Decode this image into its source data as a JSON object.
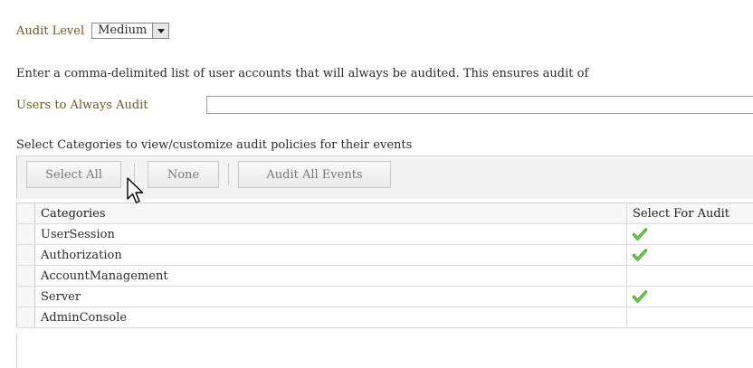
{
  "audit_level": {
    "label": "Audit Level",
    "value": "Medium"
  },
  "description": "Enter a comma-delimited list of user accounts that will always be audited. This ensures audit of",
  "users_field": {
    "label": "Users to Always Audit",
    "value": ""
  },
  "categories_heading": "Select Categories to view/customize audit policies for their events",
  "toolbar": {
    "select_all": "Select All",
    "none": "None",
    "audit_all_events": "Audit All Events"
  },
  "table": {
    "headers": [
      "Categories",
      "Select For Audit"
    ],
    "rows": [
      {
        "category": "UserSession",
        "selected": true
      },
      {
        "category": "Authorization",
        "selected": true
      },
      {
        "category": "AccountManagement",
        "selected": false
      },
      {
        "category": "Server",
        "selected": true
      },
      {
        "category": "AdminConsole",
        "selected": false
      }
    ]
  },
  "colors": {
    "label_olive": "#6b5a18",
    "check_green": "#3aa317"
  }
}
